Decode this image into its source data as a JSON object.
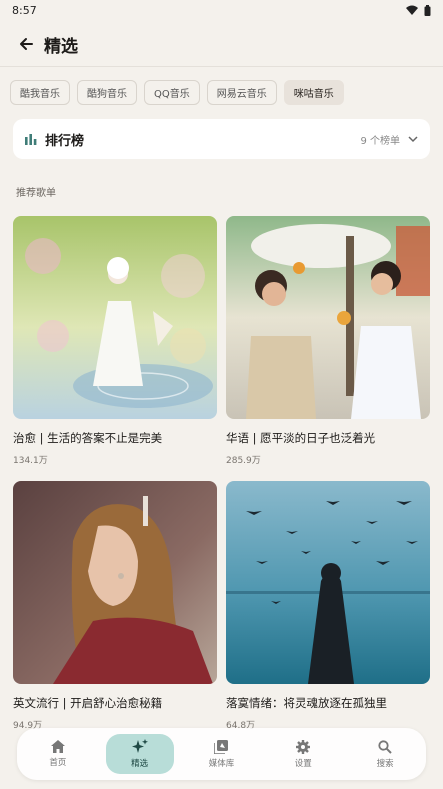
{
  "status": {
    "time": "8:57"
  },
  "header": {
    "title": "精选"
  },
  "chips": [
    {
      "label": "酷我音乐",
      "selected": false
    },
    {
      "label": "酷狗音乐",
      "selected": false
    },
    {
      "label": "QQ音乐",
      "selected": false
    },
    {
      "label": "网易云音乐",
      "selected": false
    },
    {
      "label": "咪咕音乐",
      "selected": true
    }
  ],
  "ranking": {
    "title": "排行榜",
    "count": "9 个榜单"
  },
  "section": {
    "label": "推荐歌单"
  },
  "playlists": [
    {
      "title": "治愈 | 生活的答案不止是完美",
      "plays": "134.1万"
    },
    {
      "title": "华语 | 愿平淡的日子也泛着光",
      "plays": "285.9万"
    },
    {
      "title": "英文流行 | 开启舒心治愈秘籍",
      "plays": "94.9万"
    },
    {
      "title": "落寞情绪：将灵魂放逐在孤独里",
      "plays": "64.8万"
    }
  ],
  "nav": [
    {
      "label": "首页",
      "icon": "home-icon",
      "active": false
    },
    {
      "label": "精选",
      "icon": "sparkle-icon",
      "active": true
    },
    {
      "label": "媒体库",
      "icon": "library-icon",
      "active": false
    },
    {
      "label": "设置",
      "icon": "gear-icon",
      "active": false
    },
    {
      "label": "搜索",
      "icon": "search-icon",
      "active": false
    }
  ],
  "colors": {
    "background": "#f4f1ec",
    "accent": "#b8ddd8",
    "card": "#ffffff",
    "rank_icon": "#3f7d78"
  }
}
